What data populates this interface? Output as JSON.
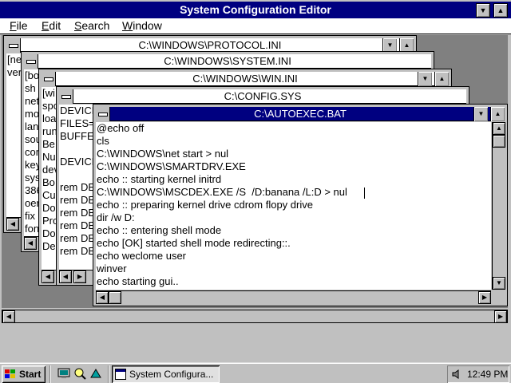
{
  "app": {
    "title": "System Configuration Editor",
    "minimize": "▼",
    "maximize": "▲"
  },
  "menu": {
    "file": {
      "u": "F",
      "rest": "ile"
    },
    "edit": {
      "u": "E",
      "rest": "dit"
    },
    "search": {
      "u": "S",
      "rest": "earch"
    },
    "window": {
      "u": "W",
      "rest": "indow"
    }
  },
  "windows": {
    "protocol": {
      "title": "C:\\WINDOWS\\PROTOCOL.INI",
      "lines": [
        "[ne",
        "ver"
      ]
    },
    "system": {
      "title": "C:\\WINDOWS\\SYSTEM.INI",
      "lines": [
        "[bo",
        "sh",
        "net",
        "mo",
        "lan",
        "sou",
        "com",
        "key",
        "sys",
        "386",
        "oer",
        "fix",
        "fon"
      ]
    },
    "win": {
      "title": "C:\\WINDOWS\\WIN.INI",
      "lines": [
        "[wi",
        "spo",
        "loa",
        "run",
        "Be",
        "Nul",
        "dev",
        "Bo",
        "Cu",
        "Do",
        "Pro",
        "Do",
        "De"
      ]
    },
    "config": {
      "title": "C:\\CONFIG.SYS",
      "lines": [
        "DEVICE",
        "FILES=",
        "BUFFE",
        "",
        "DEVICE",
        "",
        "rem DE",
        "rem DE",
        "rem DE",
        "rem DE",
        "rem DE",
        "rem DE"
      ]
    },
    "autoexec": {
      "title": "C:\\AUTOEXEC.BAT",
      "lines": [
        "@echo off",
        "cls",
        "C:\\WINDOWS\\net start > nul",
        "C:\\WINDOWS\\SMARTDRV.EXE",
        "echo :: starting kernel initrd",
        "C:\\WINDOWS\\MSCDEX.EXE /S  /D:banana /L:D > nul",
        "echo :: preparing kernel drive cdrom flopy drive",
        "dir /w D:",
        "echo :: entering shell mode",
        "echo [OK] started shell mode redirecting::.",
        "echo weclome user",
        "winver",
        "echo starting gui.."
      ]
    }
  },
  "taskbar": {
    "start_label": "Start",
    "task_label": "System Configura...",
    "clock": "12:49 PM"
  },
  "icons": {
    "start": "windows-logo-icon",
    "quicklaunch": [
      "show-desktop-icon",
      "explorer-icon",
      "channels-icon"
    ],
    "tray": "speaker-icon"
  },
  "colors": {
    "active_caption": "#000080",
    "face": "#c0c0c0",
    "workspace": "#808080"
  }
}
